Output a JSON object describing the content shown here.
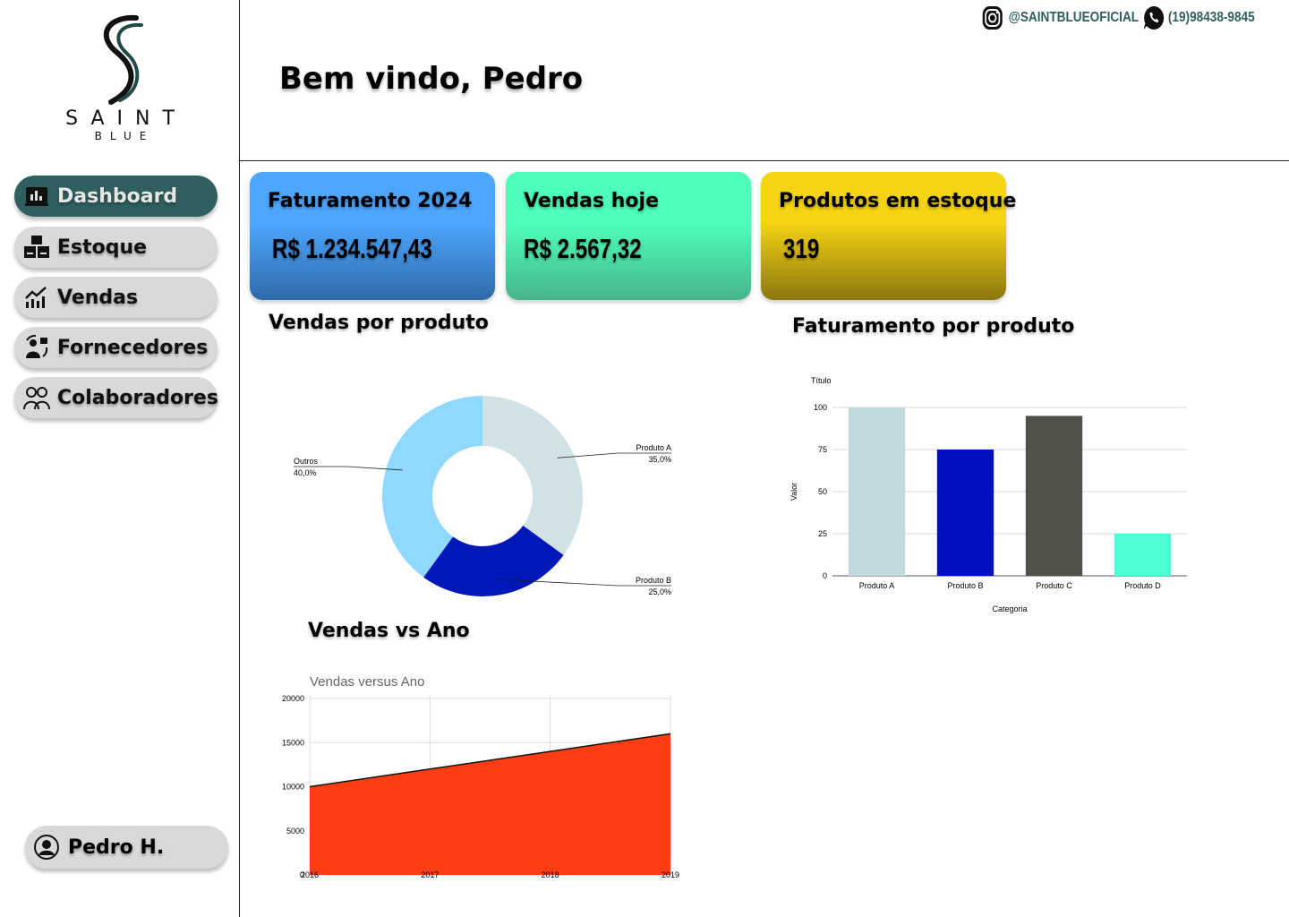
{
  "brand": {
    "name": "SAINT",
    "sub": "BLUE"
  },
  "sidebar": {
    "items": [
      {
        "label": "Dashboard",
        "icon": "bar-chart-icon",
        "active": true
      },
      {
        "label": "Estoque",
        "icon": "boxes-icon",
        "active": false
      },
      {
        "label": "Vendas",
        "icon": "trend-chart-icon",
        "active": false
      },
      {
        "label": "Fornecedores",
        "icon": "supplier-icon",
        "active": false
      },
      {
        "label": "Colaboradores",
        "icon": "team-icon",
        "active": false
      }
    ],
    "user": {
      "name": "Pedro H.",
      "icon": "user-avatar-icon"
    }
  },
  "header": {
    "welcome": "Bem vindo, Pedro",
    "instagram": "@SAINTBLUEOFICIAL",
    "phone": "(19)98438-9845"
  },
  "cards": [
    {
      "title": "Faturamento 2024",
      "value": "R$ 1.234.547,43",
      "colors": [
        "#4da6ff",
        "#2e6aa8"
      ]
    },
    {
      "title": "Vendas hoje",
      "value": "R$ 2.567,32",
      "colors": [
        "#4dffb8",
        "#47b48c"
      ]
    },
    {
      "title": "Produtos em estoque",
      "value": "319",
      "colors": [
        "#f5d414",
        "#8a760e"
      ]
    }
  ],
  "sections": {
    "pie": "Vendas por produto",
    "bar": "Faturamento por produto",
    "area": "Vendas vs Ano"
  },
  "chart_data": [
    {
      "type": "pie",
      "donut": true,
      "slices": [
        {
          "label": "Produto A",
          "value": 35.0,
          "display": "35,0%",
          "color": "#d1e2e6"
        },
        {
          "label": "Produto B",
          "value": 25.0,
          "display": "25,0%",
          "color": "#0018b8"
        },
        {
          "label": "Outros",
          "value": 40.0,
          "display": "40,0%",
          "color": "#8fd8ff"
        }
      ]
    },
    {
      "type": "bar",
      "title": "Título",
      "xlabel": "Categoria",
      "ylabel": "Valor",
      "categories": [
        "Produto A",
        "Produto B",
        "Produto C",
        "Produto D"
      ],
      "values": [
        100,
        75,
        95,
        25
      ],
      "colors": [
        "#c0d9dc",
        "#0010c0",
        "#50524a",
        "#4dffd2"
      ],
      "ylim": [
        0,
        100
      ],
      "yticks": [
        0,
        25,
        50,
        75,
        100
      ],
      "grid": true
    },
    {
      "type": "area",
      "title": "Vendas versus Ano",
      "x": [
        "2016",
        "2017",
        "2018",
        "2019"
      ],
      "values": [
        10000,
        12000,
        14000,
        16000
      ],
      "color": "#ff3d14",
      "ylim": [
        0,
        20000
      ],
      "yticks": [
        0,
        5000,
        10000,
        15000,
        20000
      ],
      "grid": true
    }
  ]
}
